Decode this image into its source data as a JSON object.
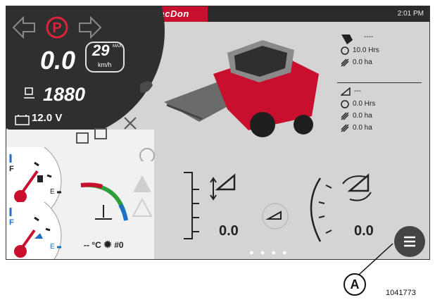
{
  "topbar": {
    "brand": "MacDon",
    "time": "2:01 PM"
  },
  "cluster": {
    "speed": "0.0",
    "speed_limit": "29",
    "speed_limit_unit": "km/h",
    "speed_limit_tag": "MAX",
    "rpm": "1880",
    "voltage": "12.0 V"
  },
  "info": {
    "header_dash": "----",
    "engine_hours": "10.0 Hrs",
    "engine_area": "0.0 ha",
    "header_dash2": "---",
    "header_hours": "0.0 Hrs",
    "header_area_1": "0.0 ha",
    "header_area_2": "0.0 ha"
  },
  "bottom": {
    "header_height_value": "0.0",
    "reel_speed_value": "0.0",
    "temp_text": "-- °C",
    "fan_value": "0"
  },
  "accent": {
    "brand_red": "#c8102e",
    "fuel_blue": "#2f7fd0",
    "gauge_red": "#c8102e"
  },
  "figure": {
    "callout": "A",
    "number": "1041773"
  }
}
